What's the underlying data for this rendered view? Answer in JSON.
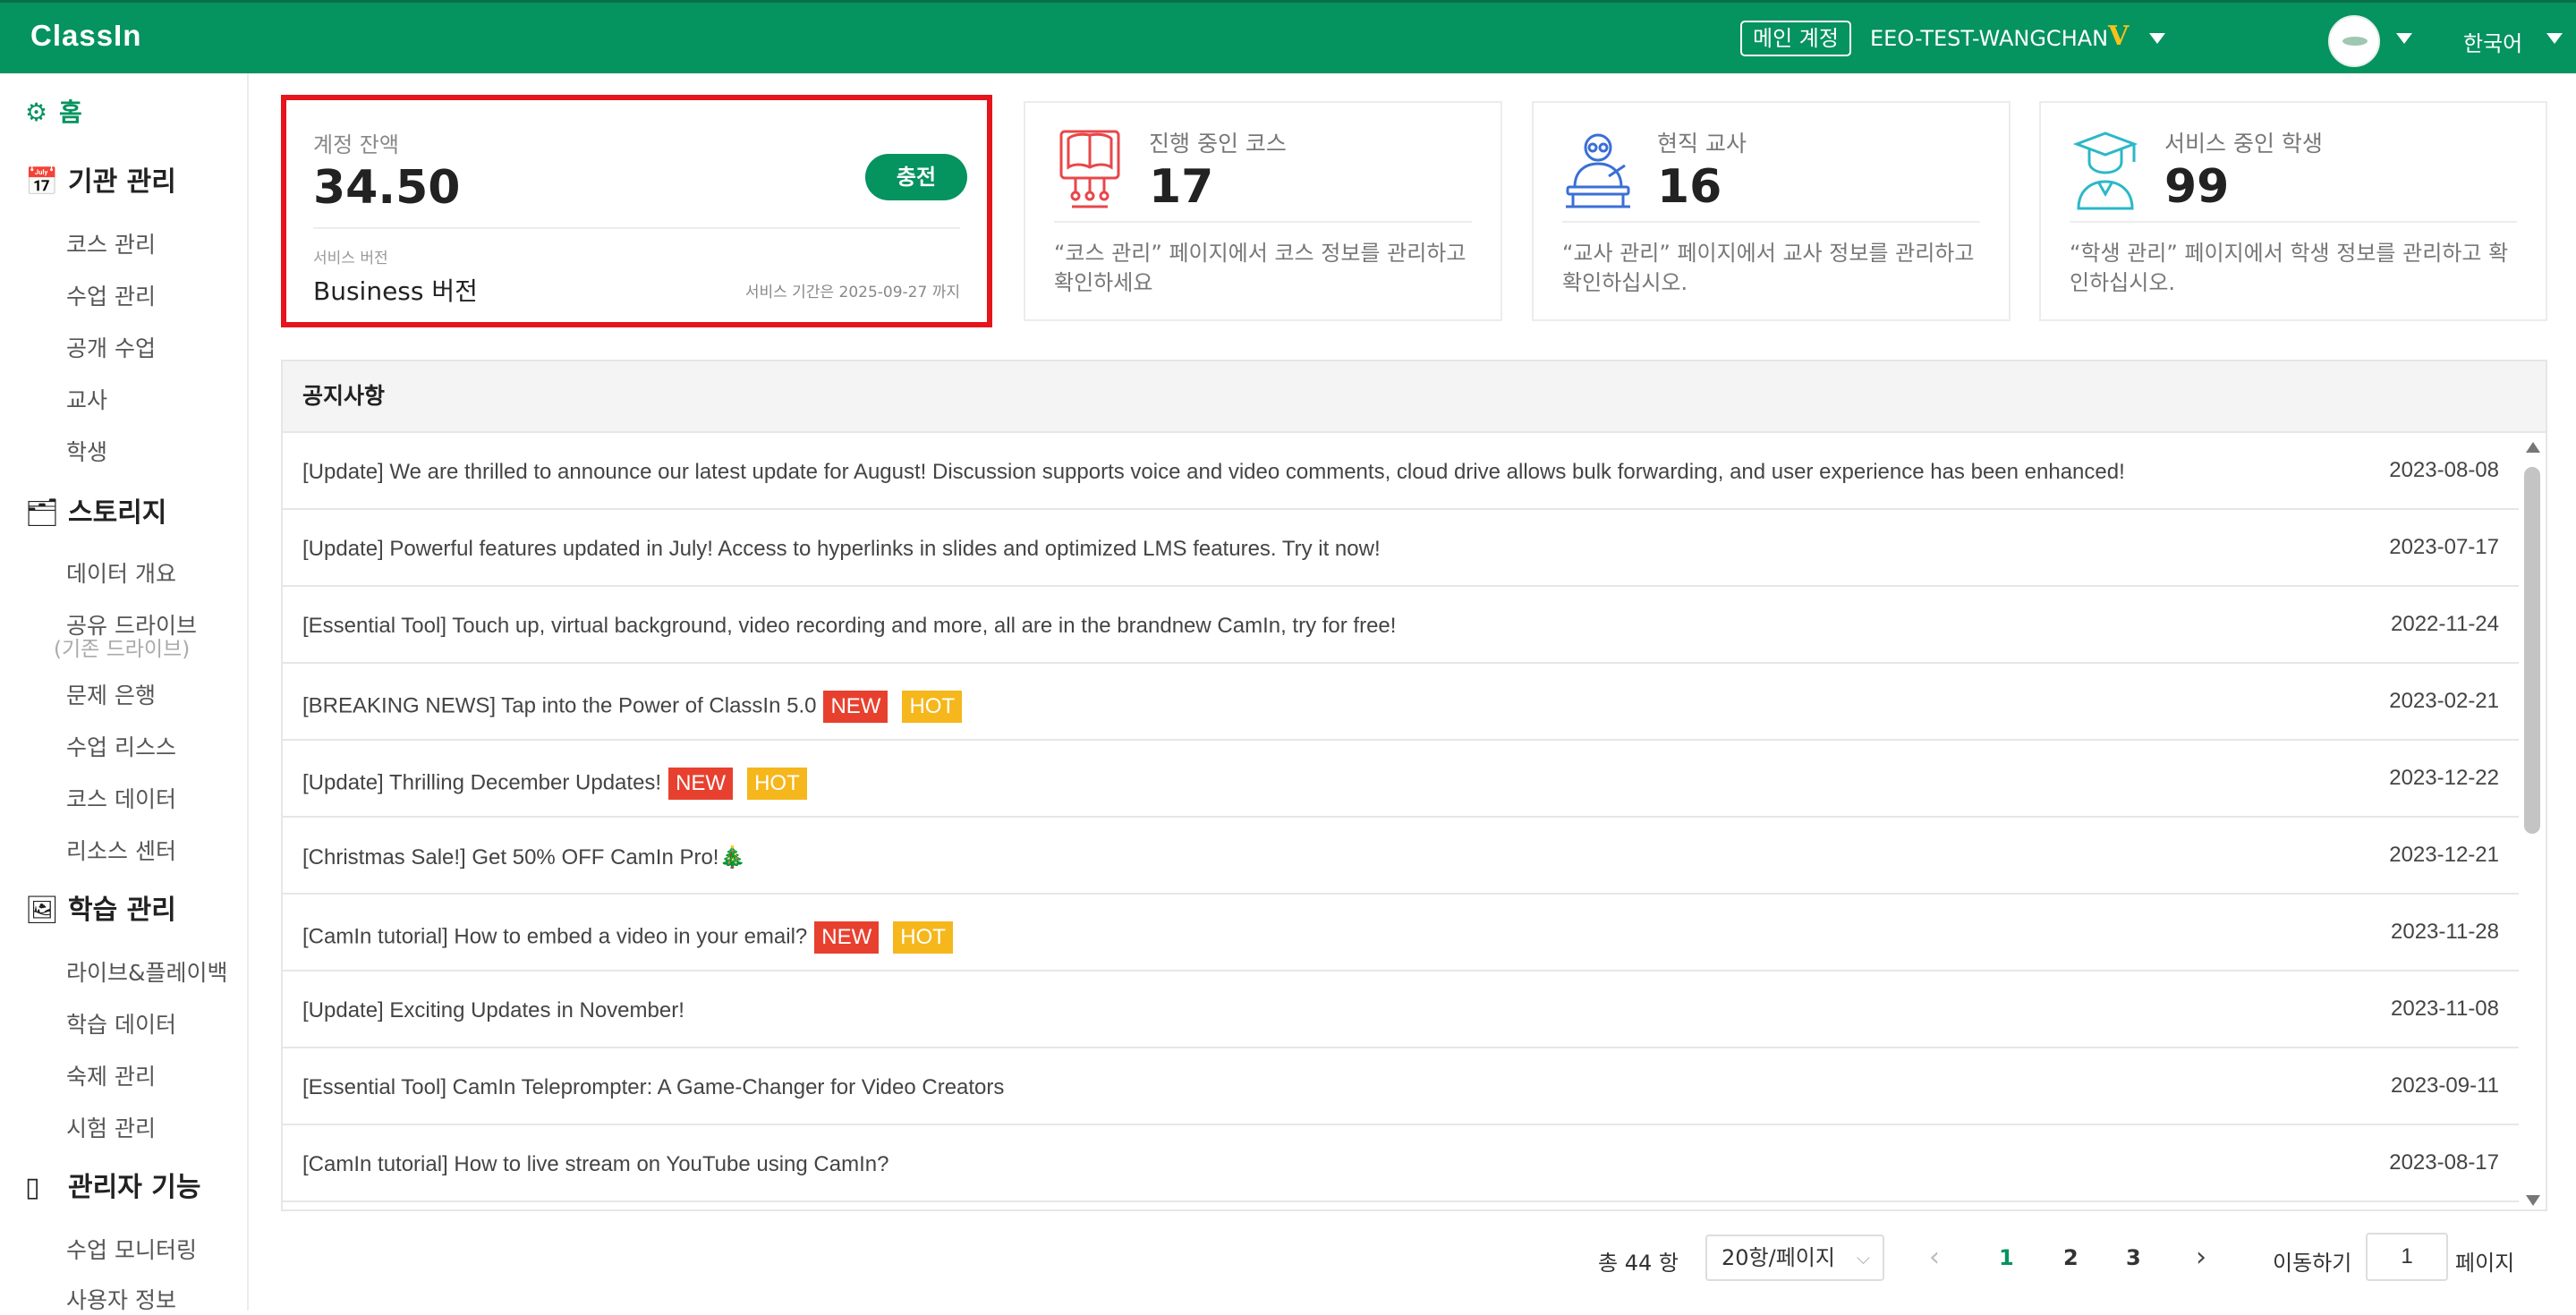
{
  "header": {
    "logo": "ClassIn",
    "main_account_label": "메인 계정",
    "account_name": "EEO-TEST-WANGCHAN",
    "vip_icon": "V",
    "language": "한국어"
  },
  "sidebar": {
    "home": "홈",
    "sections": [
      {
        "title": "기관 관리",
        "icon": "calendar-icon",
        "items": [
          "코스 관리",
          "수업 관리",
          "공개 수업",
          "교사",
          "학생"
        ]
      },
      {
        "title": "스토리지",
        "icon": "folder-icon",
        "items": [
          "데이터 개요",
          "공유 드라이브",
          "(기존 드라이브)",
          "문제 은행",
          "수업 리스스",
          "코스 데이터",
          "리소스 센터"
        ]
      },
      {
        "title": "학습 관리",
        "icon": "study-icon",
        "items": [
          "라이브&플레이백",
          "학습 데이터",
          "숙제 관리",
          "시험 관리"
        ]
      },
      {
        "title": "관리자 기능",
        "icon": "admin-icon",
        "items": [
          "수업 모니터링",
          "사용자 정보"
        ]
      }
    ]
  },
  "balance_card": {
    "label": "계정 잔액",
    "amount": "34.50",
    "charge_button": "충전",
    "service_version_label": "서비스 버전",
    "version": "Business 버전",
    "period": "서비스 기간은 2025-09-27 까지"
  },
  "stat_cards": [
    {
      "label": "진행 중인 코스",
      "value": "17",
      "desc": "“코스 관리” 페이지에서 코스 정보를 관리하고 확인하세요",
      "icon": "course-screen-icon",
      "color": "#e8474a"
    },
    {
      "label": "현직 교사",
      "value": "16",
      "desc": "“교사 관리” 페이지에서 교사 정보를 관리하고 확인하십시오.",
      "icon": "teacher-icon",
      "color": "#3b6fd6"
    },
    {
      "label": "서비스 중인 학생",
      "value": "99",
      "desc": "“학생 관리” 페이지에서 학생 정보를 관리하고 확인하십시오.",
      "icon": "graduate-icon",
      "color": "#2bb8c8"
    }
  ],
  "notices": {
    "title": "공지사항",
    "badge_new": "NEW",
    "badge_hot": "HOT",
    "rows": [
      {
        "title": "[Update] We are thrilled to announce our latest update for August! Discussion supports voice and video comments, cloud drive allows bulk forwarding, and user experience has been enhanced!",
        "date": "2023-08-08"
      },
      {
        "title": "[Update] Powerful features updated in July! Access to hyperlinks in slides and optimized LMS features. Try it now!",
        "date": "2023-07-17"
      },
      {
        "title": "[Essential Tool] Touch up, virtual background, video recording and more, all are in the brandnew CamIn, try for free!",
        "date": "2022-11-24"
      },
      {
        "title": "[BREAKING NEWS] Tap into the Power of ClassIn 5.0",
        "date": "2023-02-21"
      },
      {
        "title": "[Update] Thrilling December Updates!",
        "date": "2023-12-22"
      },
      {
        "title": "[Christmas Sale!] Get 50% OFF CamIn Pro!🎄",
        "date": "2023-12-21"
      },
      {
        "title": "[CamIn tutorial] How to embed a video in your email?",
        "date": "2023-11-28"
      },
      {
        "title": "[Update] Exciting Updates in November!",
        "date": "2023-11-08"
      },
      {
        "title": "[Essential Tool] CamIn Teleprompter: A Game-Changer for Video Creators",
        "date": "2023-09-11"
      },
      {
        "title": "[CamIn tutorial] How to live stream on YouTube using CamIn?",
        "date": "2023-08-17"
      }
    ]
  },
  "pagination": {
    "total": "총 44 항",
    "page_size": "20항/페이지",
    "pages": [
      "1",
      "2",
      "3"
    ],
    "current_page": "1",
    "jump_label": "이동하기",
    "jump_value": "1",
    "page_suffix": "페이지"
  },
  "colors": {
    "brand": "#05935f",
    "highlight_border": "#e5151b",
    "badge_new": "#e8402f",
    "badge_hot": "#f5b71c"
  }
}
